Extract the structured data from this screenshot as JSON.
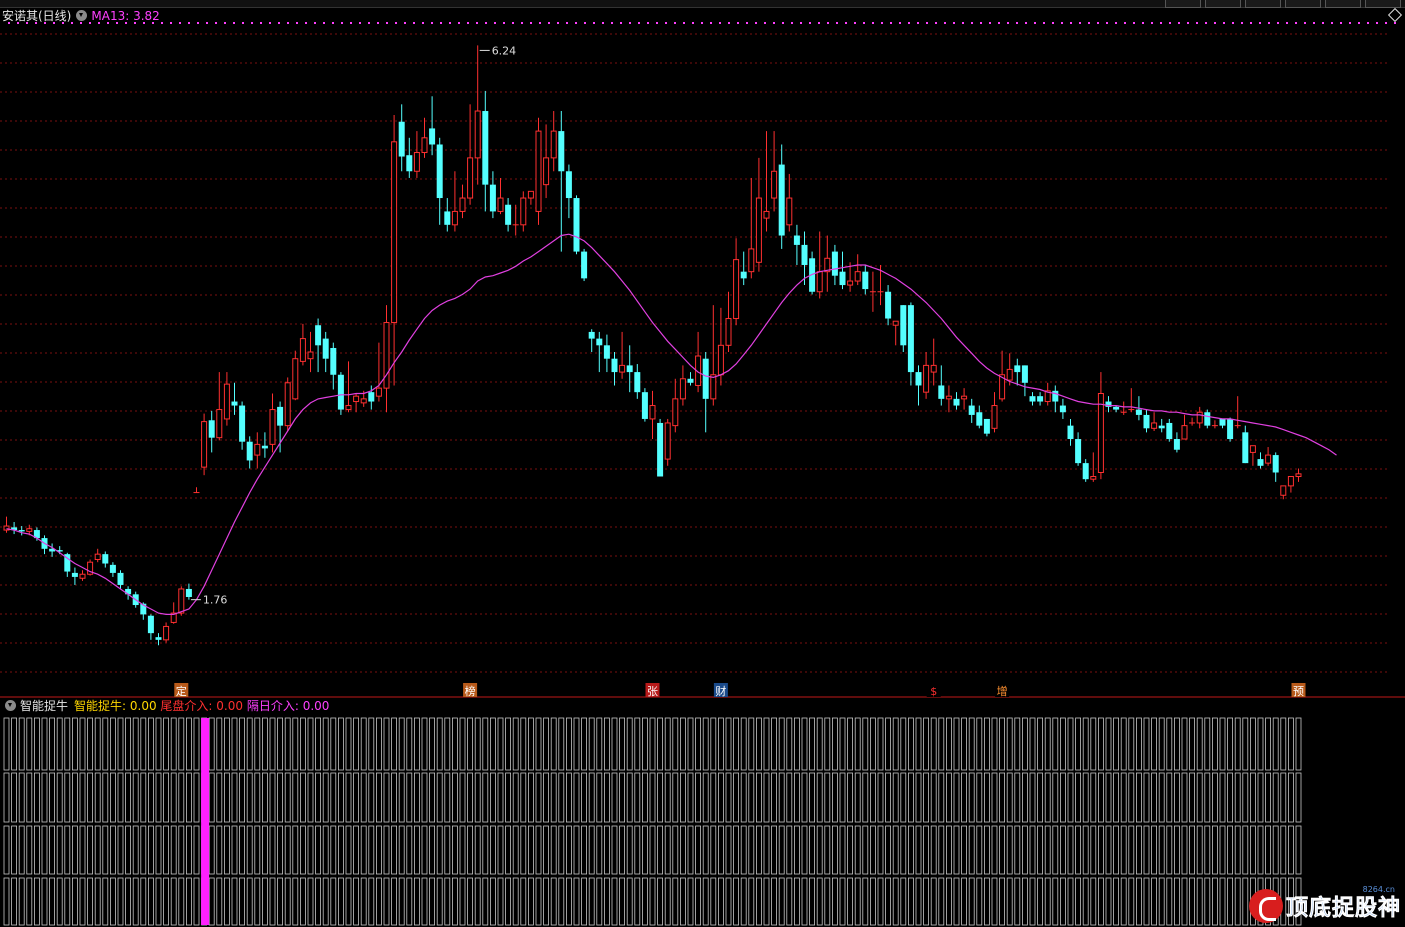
{
  "window": {
    "stock_title": "安诺其(日线)",
    "ma_label": "MA13: 3.82"
  },
  "indicator": {
    "name": "智能捉牛",
    "values": [
      {
        "label": "智能捉牛: ",
        "value": "0.00",
        "color": "#ffd700"
      },
      {
        "label": "尾盘介入: ",
        "value": "0.00",
        "color": "#ff3030"
      },
      {
        "label": "隔日介入: ",
        "value": "0.00",
        "color": "#ff40ff"
      }
    ]
  },
  "watermark": {
    "text": "顶底捉股神",
    "site": "8264.cn"
  },
  "colors": {
    "up": "#ff3030",
    "down": "#54ffff",
    "ma": "#e040e0",
    "grid": "#7a1010",
    "bar_outline": "#c8c8c8",
    "highlight_bar": "#ff20ff"
  },
  "chart_data": {
    "type": "candlestick",
    "title": "安诺其(日线)",
    "ylim": [
      1.5,
      6.4
    ],
    "annotations": [
      {
        "index": 62,
        "text": "6.24",
        "kind": "high"
      },
      {
        "index": 24,
        "text": "1.76",
        "kind": "low"
      }
    ],
    "event_markers": [
      {
        "index": 23,
        "text": "定",
        "bg": "#b85a1a",
        "fg": "#ffffff"
      },
      {
        "index": 61,
        "text": "榜",
        "bg": "#b85a1a",
        "fg": "#ffffff"
      },
      {
        "index": 85,
        "text": "张",
        "bg": "#b81a1a",
        "fg": "#ffffff"
      },
      {
        "index": 94,
        "text": "财",
        "bg": "#1a4a8a",
        "fg": "#ffffff"
      },
      {
        "index": 122,
        "text": "$",
        "bg": "#000000",
        "fg": "#ff3030"
      },
      {
        "index": 131,
        "text": "增",
        "bg": "#000000",
        "fg": "#ff9030"
      },
      {
        "index": 170,
        "text": "预",
        "bg": "#b85a1a",
        "fg": "#ffffff"
      }
    ],
    "signal_bar_index": 26,
    "ohlc": [
      [
        2.62,
        2.65,
        2.72,
        2.6
      ],
      [
        2.64,
        2.62,
        2.68,
        2.59
      ],
      [
        2.62,
        2.61,
        2.65,
        2.58
      ],
      [
        2.61,
        2.63,
        2.66,
        2.58
      ],
      [
        2.62,
        2.56,
        2.64,
        2.54
      ],
      [
        2.56,
        2.48,
        2.58,
        2.44
      ],
      [
        2.48,
        2.46,
        2.52,
        2.42
      ],
      [
        2.47,
        2.46,
        2.5,
        2.44
      ],
      [
        2.44,
        2.31,
        2.45,
        2.27
      ],
      [
        2.3,
        2.27,
        2.34,
        2.21
      ],
      [
        2.26,
        2.29,
        2.32,
        2.24
      ],
      [
        2.29,
        2.38,
        2.4,
        2.28
      ],
      [
        2.4,
        2.44,
        2.48,
        2.38
      ],
      [
        2.44,
        2.37,
        2.46,
        2.34
      ],
      [
        2.36,
        2.3,
        2.38,
        2.27
      ],
      [
        2.3,
        2.21,
        2.32,
        2.18
      ],
      [
        2.18,
        2.14,
        2.2,
        2.1
      ],
      [
        2.14,
        2.06,
        2.16,
        2.04
      ],
      [
        2.07,
        1.99,
        2.08,
        1.95
      ],
      [
        1.98,
        1.85,
        1.99,
        1.8
      ],
      [
        1.82,
        1.8,
        1.85,
        1.76
      ],
      [
        1.8,
        1.9,
        1.93,
        1.78
      ],
      [
        1.93,
        2.0,
        2.08,
        1.92
      ],
      [
        2.0,
        2.18,
        2.2,
        1.98
      ],
      [
        2.18,
        2.12,
        2.22,
        2.1
      ],
      [
        2.9,
        2.9,
        2.94,
        2.9
      ],
      [
        3.09,
        3.43,
        3.49,
        3.03
      ],
      [
        3.44,
        3.31,
        3.51,
        3.2
      ],
      [
        3.31,
        3.52,
        3.8,
        3.29
      ],
      [
        3.45,
        3.71,
        3.8,
        3.4
      ],
      [
        3.58,
        3.55,
        3.72,
        3.48
      ],
      [
        3.55,
        3.28,
        3.58,
        3.22
      ],
      [
        3.28,
        3.14,
        3.32,
        3.08
      ],
      [
        3.18,
        3.26,
        3.35,
        3.08
      ],
      [
        3.25,
        3.23,
        3.35,
        3.16
      ],
      [
        3.26,
        3.52,
        3.64,
        3.2
      ],
      [
        3.54,
        3.4,
        3.58,
        3.2
      ],
      [
        3.4,
        3.72,
        3.76,
        3.36
      ],
      [
        3.6,
        3.9,
        3.96,
        3.59
      ],
      [
        3.88,
        4.05,
        4.16,
        3.85
      ],
      [
        3.9,
        3.95,
        4.1,
        3.8
      ],
      [
        4.15,
        4.0,
        4.2,
        3.8
      ],
      [
        4.05,
        3.9,
        4.1,
        3.8
      ],
      [
        3.98,
        3.78,
        4.02,
        3.67
      ],
      [
        3.78,
        3.52,
        3.8,
        3.48
      ],
      [
        3.52,
        3.55,
        3.88,
        3.5
      ],
      [
        3.58,
        3.62,
        3.64,
        3.5
      ],
      [
        3.57,
        3.6,
        3.66,
        3.54
      ],
      [
        3.65,
        3.58,
        3.7,
        3.52
      ],
      [
        3.62,
        3.68,
        4.02,
        3.58
      ],
      [
        3.68,
        4.17,
        4.3,
        3.5
      ],
      [
        4.17,
        5.52,
        5.72,
        3.7
      ],
      [
        5.67,
        5.41,
        5.8,
        5.3
      ],
      [
        5.42,
        5.3,
        5.55,
        5.25
      ],
      [
        5.3,
        5.44,
        5.6,
        5.25
      ],
      [
        5.44,
        5.55,
        5.7,
        5.4
      ],
      [
        5.62,
        5.5,
        5.86,
        5.42
      ],
      [
        5.5,
        5.1,
        5.55,
        4.9
      ],
      [
        5.0,
        4.9,
        5.1,
        4.85
      ],
      [
        4.9,
        5.0,
        5.3,
        4.85
      ],
      [
        5.0,
        5.1,
        5.2,
        4.95
      ],
      [
        5.1,
        5.4,
        5.8,
        5.05
      ],
      [
        5.4,
        5.75,
        6.24,
        5.2
      ],
      [
        5.75,
        5.2,
        5.9,
        5.0
      ],
      [
        5.2,
        5.0,
        5.3,
        4.95
      ],
      [
        5.0,
        5.1,
        5.25,
        4.98
      ],
      [
        5.05,
        4.9,
        5.1,
        4.85
      ],
      [
        4.9,
        4.9,
        5.05,
        4.82
      ],
      [
        4.9,
        5.1,
        5.15,
        4.85
      ],
      [
        5.1,
        5.15,
        5.1,
        5.05
      ],
      [
        5.0,
        5.6,
        5.7,
        4.9
      ],
      [
        5.2,
        5.4,
        5.65,
        5.1
      ],
      [
        5.4,
        5.6,
        5.75,
        5.3
      ],
      [
        5.6,
        5.3,
        5.75,
        4.7
      ],
      [
        5.3,
        5.1,
        5.35,
        4.95
      ],
      [
        5.1,
        4.7,
        5.12,
        4.68
      ],
      [
        4.7,
        4.5,
        4.72,
        4.48
      ],
      [
        4.1,
        4.05,
        4.12,
        3.95
      ],
      [
        4.05,
        4.0,
        4.1,
        3.8
      ],
      [
        4.0,
        3.9,
        4.08,
        3.8
      ],
      [
        3.9,
        3.8,
        3.95,
        3.7
      ],
      [
        3.8,
        3.85,
        4.1,
        3.75
      ],
      [
        3.85,
        3.8,
        4.0,
        3.65
      ],
      [
        3.8,
        3.65,
        3.86,
        3.6
      ],
      [
        3.65,
        3.45,
        3.68,
        3.43
      ],
      [
        3.45,
        3.55,
        3.66,
        3.3
      ],
      [
        3.42,
        3.02,
        3.45,
        3.02
      ],
      [
        3.15,
        3.42,
        3.45,
        3.1
      ],
      [
        3.4,
        3.6,
        3.75,
        3.35
      ],
      [
        3.6,
        3.75,
        3.85,
        3.55
      ],
      [
        3.75,
        3.72,
        3.8,
        3.7
      ],
      [
        3.7,
        3.92,
        4.1,
        3.65
      ],
      [
        3.9,
        3.6,
        3.95,
        3.35
      ],
      [
        3.6,
        3.78,
        4.3,
        3.55
      ],
      [
        3.78,
        4.0,
        4.28,
        3.7
      ],
      [
        4.0,
        4.2,
        4.4,
        3.95
      ],
      [
        4.2,
        4.64,
        4.8,
        4.15
      ],
      [
        4.55,
        4.5,
        4.7,
        4.45
      ],
      [
        4.55,
        4.72,
        5.25,
        4.5
      ],
      [
        4.62,
        5.1,
        5.4,
        4.55
      ],
      [
        4.95,
        5.0,
        5.6,
        4.85
      ],
      [
        5.1,
        5.3,
        5.6,
        5.0
      ],
      [
        5.35,
        4.82,
        5.5,
        4.72
      ],
      [
        4.9,
        5.1,
        5.28,
        4.85
      ],
      [
        4.82,
        4.75,
        4.9,
        4.6
      ],
      [
        4.75,
        4.6,
        4.85,
        4.45
      ],
      [
        4.65,
        4.4,
        4.7,
        4.38
      ],
      [
        4.4,
        4.55,
        4.85,
        4.35
      ],
      [
        4.55,
        4.65,
        4.82,
        4.4
      ],
      [
        4.7,
        4.52,
        4.75,
        4.45
      ],
      [
        4.55,
        4.45,
        4.7,
        4.42
      ],
      [
        4.45,
        4.48,
        4.62,
        4.4
      ],
      [
        4.48,
        4.55,
        4.68,
        4.45
      ],
      [
        4.55,
        4.42,
        4.6,
        4.38
      ],
      [
        4.4,
        4.4,
        4.55,
        4.25
      ],
      [
        4.4,
        4.4,
        4.6,
        4.3
      ],
      [
        4.4,
        4.2,
        4.45,
        4.15
      ],
      [
        4.15,
        4.18,
        4.15,
        4.0
      ],
      [
        4.3,
        4.0,
        4.3,
        3.95
      ],
      [
        4.3,
        3.8,
        4.32,
        3.7
      ],
      [
        3.8,
        3.7,
        3.85,
        3.55
      ],
      [
        3.65,
        3.85,
        3.95,
        3.6
      ],
      [
        3.8,
        3.85,
        4.05,
        3.7
      ],
      [
        3.7,
        3.6,
        3.85,
        3.55
      ],
      [
        3.6,
        3.62,
        3.7,
        3.5
      ],
      [
        3.6,
        3.55,
        3.65,
        3.52
      ],
      [
        3.6,
        3.62,
        3.68,
        3.52
      ],
      [
        3.55,
        3.48,
        3.6,
        3.42
      ],
      [
        3.5,
        3.4,
        3.55,
        3.38
      ],
      [
        3.45,
        3.34,
        3.45,
        3.32
      ],
      [
        3.38,
        3.55,
        3.65,
        3.35
      ],
      [
        3.6,
        3.78,
        3.96,
        3.58
      ],
      [
        3.74,
        3.82,
        3.94,
        3.7
      ],
      [
        3.85,
        3.8,
        3.9,
        3.7
      ],
      [
        3.85,
        3.72,
        3.85,
        3.62
      ],
      [
        3.62,
        3.58,
        3.65,
        3.55
      ],
      [
        3.62,
        3.58,
        3.65,
        3.55
      ],
      [
        3.58,
        3.66,
        3.72,
        3.55
      ],
      [
        3.66,
        3.58,
        3.7,
        3.5
      ],
      [
        3.55,
        3.5,
        3.6,
        3.45
      ],
      [
        3.4,
        3.3,
        3.45,
        3.25
      ],
      [
        3.3,
        3.12,
        3.35,
        3.1
      ],
      [
        3.12,
        3.0,
        3.15,
        2.98
      ],
      [
        3.0,
        3.02,
        3.2,
        2.98
      ],
      [
        3.05,
        3.64,
        3.8,
        3.0
      ],
      [
        3.58,
        3.54,
        3.62,
        3.5
      ],
      [
        3.54,
        3.52,
        3.55,
        3.5
      ],
      [
        3.5,
        3.5,
        3.58,
        3.48
      ],
      [
        3.52,
        3.52,
        3.68,
        3.5
      ],
      [
        3.52,
        3.48,
        3.62,
        3.44
      ],
      [
        3.48,
        3.38,
        3.52,
        3.35
      ],
      [
        3.38,
        3.42,
        3.5,
        3.36
      ],
      [
        3.4,
        3.38,
        3.45,
        3.35
      ],
      [
        3.42,
        3.3,
        3.45,
        3.28
      ],
      [
        3.3,
        3.22,
        3.35,
        3.2
      ],
      [
        3.3,
        3.4,
        3.48,
        3.3
      ],
      [
        3.42,
        3.42,
        3.46,
        3.4
      ],
      [
        3.42,
        3.5,
        3.54,
        3.38
      ],
      [
        3.5,
        3.4,
        3.52,
        3.38
      ],
      [
        3.4,
        3.4,
        3.44,
        3.38
      ],
      [
        3.45,
        3.4,
        3.42,
        3.38
      ],
      [
        3.45,
        3.3,
        3.46,
        3.28
      ],
      [
        3.4,
        3.4,
        3.62,
        3.38
      ],
      [
        3.35,
        3.12,
        3.4,
        3.12
      ],
      [
        3.2,
        3.25,
        3.22,
        3.1
      ],
      [
        3.15,
        3.1,
        3.2,
        3.08
      ],
      [
        3.12,
        3.18,
        3.24,
        3.1
      ],
      [
        3.18,
        3.05,
        3.2,
        2.98
      ],
      [
        2.88,
        2.95,
        2.95,
        2.85
      ],
      [
        2.95,
        3.02,
        3.02,
        2.9
      ],
      [
        3.02,
        3.04,
        3.08,
        2.98
      ]
    ],
    "ma13": [
      2.63,
      2.62,
      2.6,
      2.59,
      2.56,
      2.52,
      2.49,
      2.45,
      2.41,
      2.37,
      2.34,
      2.31,
      2.29,
      2.26,
      2.22,
      2.18,
      2.14,
      2.1,
      2.06,
      2.03,
      2.0,
      1.99,
      1.99,
      2.01,
      2.03,
      2.1,
      2.2,
      2.32,
      2.44,
      2.56,
      2.68,
      2.79,
      2.9,
      3.0,
      3.09,
      3.18,
      3.27,
      3.36,
      3.45,
      3.52,
      3.57,
      3.6,
      3.61,
      3.62,
      3.63,
      3.63,
      3.64,
      3.64,
      3.66,
      3.7,
      3.78,
      3.87,
      3.95,
      4.04,
      4.12,
      4.2,
      4.26,
      4.3,
      4.33,
      4.35,
      4.38,
      4.42,
      4.48,
      4.51,
      4.52,
      4.54,
      4.56,
      4.59,
      4.63,
      4.66,
      4.7,
      4.74,
      4.78,
      4.82,
      4.83,
      4.81,
      4.78,
      4.73,
      4.67,
      4.61,
      4.55,
      4.48,
      4.41,
      4.33,
      4.25,
      4.17,
      4.1,
      4.03,
      3.97,
      3.91,
      3.85,
      3.8,
      3.77,
      3.76,
      3.78,
      3.81,
      3.86,
      3.93,
      4.0,
      4.08,
      4.16,
      4.24,
      4.32,
      4.39,
      4.45,
      4.5,
      4.53,
      4.55,
      4.56,
      4.57,
      4.58,
      4.59,
      4.6,
      4.6,
      4.58,
      4.56,
      4.53,
      4.5,
      4.46,
      4.42,
      4.37,
      4.32,
      4.26,
      4.2,
      4.13,
      4.06,
      4.0,
      3.94,
      3.88,
      3.83,
      3.79,
      3.76,
      3.73,
      3.71,
      3.69,
      3.68,
      3.67,
      3.65,
      3.64,
      3.62,
      3.6,
      3.58,
      3.57,
      3.56,
      3.56,
      3.55,
      3.55,
      3.54,
      3.54,
      3.53,
      3.52,
      3.51,
      3.51,
      3.5,
      3.5,
      3.49,
      3.48,
      3.48,
      3.47,
      3.46,
      3.45,
      3.45,
      3.44,
      3.43,
      3.42,
      3.41,
      3.4,
      3.39,
      3.37,
      3.35,
      3.33,
      3.31,
      3.28,
      3.25,
      3.22,
      3.18
    ]
  }
}
